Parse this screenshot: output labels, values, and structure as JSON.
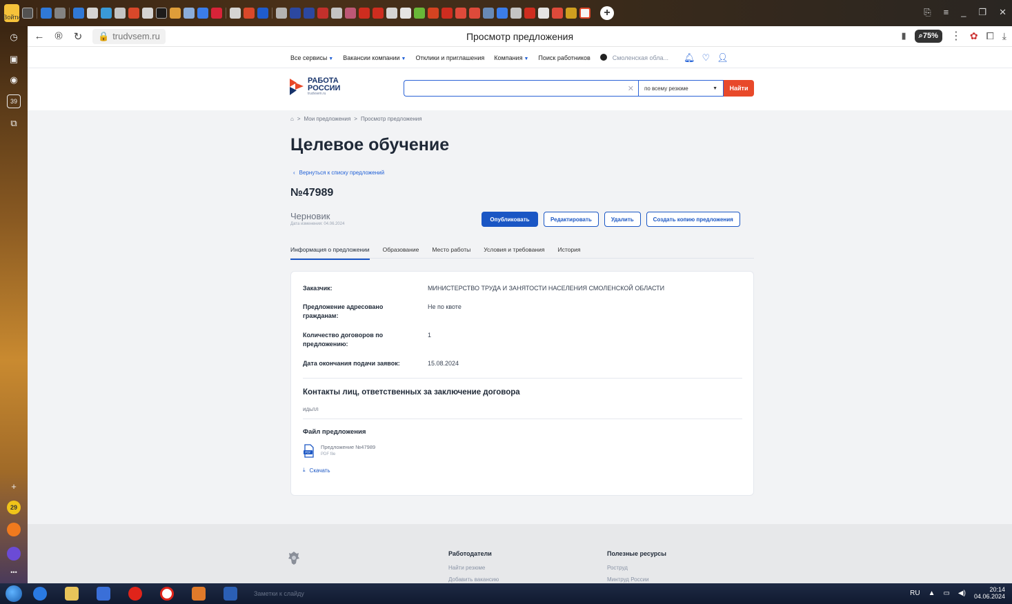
{
  "browser": {
    "url": "trudvsem.ru",
    "page_title": "Просмотр предложения",
    "zoom": "75%",
    "login_label": "Войти",
    "badge_counts": {
      "sidebar_39": "39",
      "sidebar_29": "29"
    }
  },
  "topnav": {
    "items": [
      "Все сервисы",
      "Вакансии компании",
      "Отклики и приглашения",
      "Компания",
      "Поиск работников"
    ],
    "region": "Смоленская обла..."
  },
  "logo": {
    "line1": "РАБОТА",
    "line2": "РОССИИ",
    "line3": "trudvsem.ru"
  },
  "search": {
    "placeholder": "",
    "scope": "по всему резюме",
    "button": "Найти"
  },
  "breadcrumb": {
    "home": "⌂",
    "items": [
      "Мои предложения",
      "Просмотр предложения"
    ],
    "sep": ">"
  },
  "page": {
    "title": "Целевое обучение",
    "back": "Вернуться к списку предложений",
    "number": "№47989",
    "status": "Черновик",
    "status_date": "Дата изменения: 04.06.2024"
  },
  "actions": {
    "publish": "Опубликовать",
    "edit": "Редактировать",
    "delete": "Удалить",
    "copy": "Создать копию предложения"
  },
  "tabs": [
    "Информация о предложении",
    "Образование",
    "Место работы",
    "Условия и требования",
    "История"
  ],
  "info": {
    "rows": [
      {
        "label": "Заказчик:",
        "value": "МИНИСТЕРСТВО ТРУДА И ЗАНЯТОСТИ НАСЕЛЕНИЯ СМОЛЕНСКОЙ ОБЛАСТИ"
      },
      {
        "label": "Предложение адресовано гражданам:",
        "value": "Не по квоте"
      },
      {
        "label": "Количество договоров по предложению:",
        "value": "1"
      },
      {
        "label": "Дата окончания подачи заявок:",
        "value": "15.08.2024"
      }
    ],
    "contacts_title": "Контакты лиц, ответственных за заключение договора",
    "contacts_value": "идьлл",
    "file_title": "Файл предложения",
    "file_name": "Предложение №47989",
    "file_type": "PDF file",
    "download": "Скачать"
  },
  "footer": {
    "col1_title": "Работодатели",
    "col1_link1": "Найти резюме",
    "col1_link2": "Добавить вакансию",
    "col2_title": "Полезные ресурсы",
    "col2_link1": "Роструд",
    "col2_link2": "Минтруд России"
  },
  "taskbar": {
    "lang": "RU",
    "time": "20:14",
    "date": "04.06.2024",
    "snippet": "Заметки к слайду"
  },
  "colors": {
    "primary": "#1a56c4",
    "accent_red": "#e8492a",
    "brand_navy": "#17336b"
  }
}
